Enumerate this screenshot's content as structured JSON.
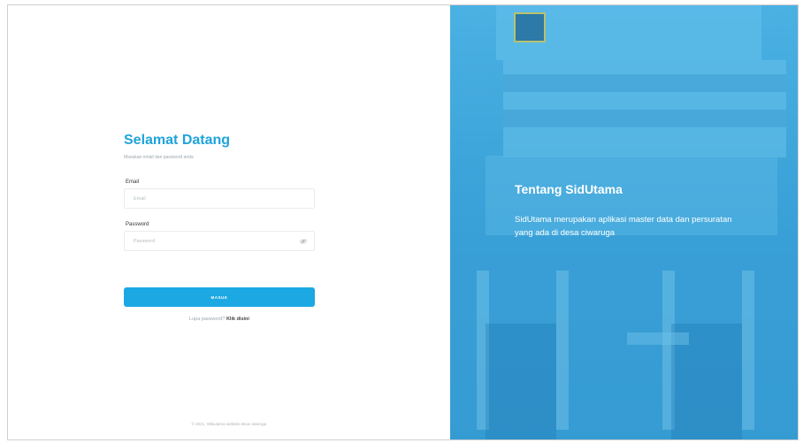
{
  "login": {
    "title": "Selamat Datang",
    "subtitle": "Masukan email dan password anda",
    "email_label": "Email",
    "email_placeholder": "Email",
    "password_label": "Password",
    "password_placeholder": "Password",
    "submit_label": "MASUK",
    "forgot_text": "Lupa password?",
    "forgot_link": "Klik disini"
  },
  "footer": {
    "text": "© 2021, Wikiutama website desa ciwaruga"
  },
  "info": {
    "title": "Tentang SidUtama",
    "description": "SidUtama merupakan aplikasi master data dan persuratan yang ada di desa ciwaruga"
  },
  "colors": {
    "accent": "#1ca8e3",
    "panel": "#3aa6dc"
  }
}
